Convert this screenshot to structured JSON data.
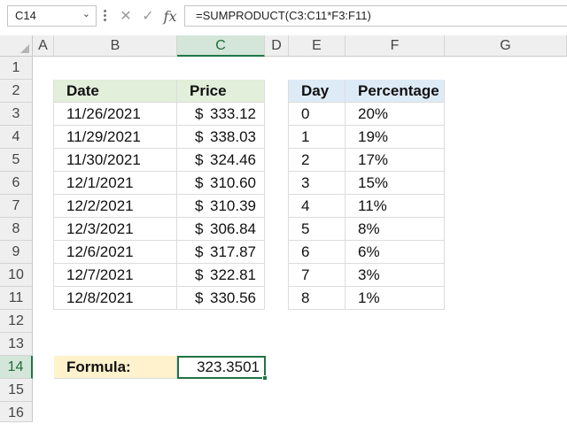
{
  "name_box": "C14",
  "formula_bar": {
    "fx_label": "fx",
    "formula": "=SUMPRODUCT(C3:C11*F3:F11)"
  },
  "columns": [
    "A",
    "B",
    "C",
    "D",
    "E",
    "F",
    "G"
  ],
  "rows": [
    "1",
    "2",
    "3",
    "4",
    "5",
    "6",
    "7",
    "8",
    "9",
    "10",
    "11",
    "12",
    "13",
    "14",
    "15",
    "16"
  ],
  "table1": {
    "headers": [
      "Date",
      "Price"
    ],
    "currency": "$",
    "rows": [
      [
        "11/26/2021",
        "333.12"
      ],
      [
        "11/29/2021",
        "338.03"
      ],
      [
        "11/30/2021",
        "324.46"
      ],
      [
        "12/1/2021",
        "310.60"
      ],
      [
        "12/2/2021",
        "310.39"
      ],
      [
        "12/3/2021",
        "306.84"
      ],
      [
        "12/6/2021",
        "317.87"
      ],
      [
        "12/7/2021",
        "322.81"
      ],
      [
        "12/8/2021",
        "330.56"
      ]
    ]
  },
  "table2": {
    "headers": [
      "Day",
      "Percentage"
    ],
    "rows": [
      [
        "0",
        "20%"
      ],
      [
        "1",
        "19%"
      ],
      [
        "2",
        "17%"
      ],
      [
        "3",
        "15%"
      ],
      [
        "4",
        "11%"
      ],
      [
        "5",
        "8%"
      ],
      [
        "6",
        "6%"
      ],
      [
        "7",
        "3%"
      ],
      [
        "8",
        "1%"
      ]
    ]
  },
  "formula_label": "Formula:",
  "formula_result": "323.3501",
  "colors": {
    "accent": "#217346",
    "green_header": "#e2efda",
    "blue_header": "#ddebf7",
    "label_fill": "#fff2cc"
  }
}
